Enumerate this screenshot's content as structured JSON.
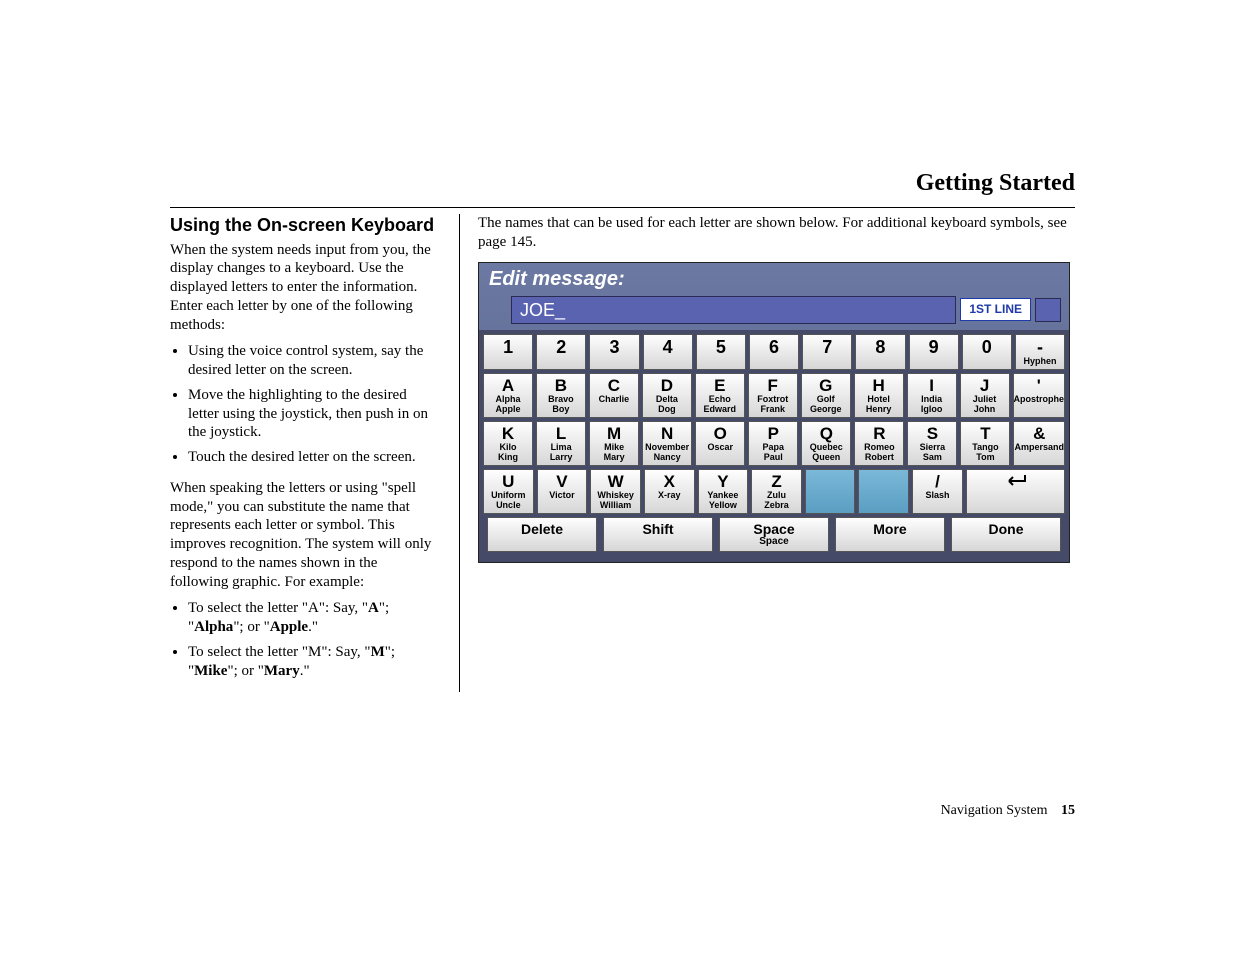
{
  "section_title": "Getting Started",
  "left": {
    "heading": "Using the On-screen Keyboard",
    "para1": "When the system needs input from you, the display changes to a keyboard. Use the displayed letters to enter the information. Enter each letter by one of the following methods:",
    "bullets1": [
      "Using the voice control system, say the desired letter on the screen.",
      "Move the highlighting to the desired letter using the joystick, then push in on the joystick.",
      "Touch the desired letter on the screen."
    ],
    "para2": "When speaking the letters or using \"spell mode,\" you can substitute the name that represents each letter or symbol. This improves recognition. The system will only respond to the names shown in the following graphic. For example:",
    "ex_a_1": "To select the letter \"A\": Say, \"",
    "ex_a_A": "A",
    "ex_a_2": "\"; \"",
    "ex_a_Alpha": "Alpha",
    "ex_a_3": "\"; or \"",
    "ex_a_Apple": "Apple",
    "ex_a_4": ".\"",
    "ex_m_1": "To select the letter \"M\": Say, \"",
    "ex_m_M": "M",
    "ex_m_2": "\"; \"",
    "ex_m_Mike": "Mike",
    "ex_m_3": "\"; or \"",
    "ex_m_Mary": "Mary",
    "ex_m_4": ".\""
  },
  "right_intro": "The names that can be used for each letter are shown below. For additional keyboard symbols, see page 145.",
  "kbd": {
    "title": "Edit message:",
    "input_value": "JOE_",
    "line_button": "1ST LINE",
    "row_nums": [
      {
        "big": "1"
      },
      {
        "big": "2"
      },
      {
        "big": "3"
      },
      {
        "big": "4"
      },
      {
        "big": "5"
      },
      {
        "big": "6"
      },
      {
        "big": "7"
      },
      {
        "big": "8"
      },
      {
        "big": "9"
      },
      {
        "big": "0"
      },
      {
        "big": "-",
        "sm": "Hyphen"
      }
    ],
    "row_a": [
      {
        "big": "A",
        "sm": "Alpha",
        "sm2": "Apple"
      },
      {
        "big": "B",
        "sm": "Bravo",
        "sm2": "Boy"
      },
      {
        "big": "C",
        "sm": "Charlie"
      },
      {
        "big": "D",
        "sm": "Delta",
        "sm2": "Dog"
      },
      {
        "big": "E",
        "sm": "Echo",
        "sm2": "Edward"
      },
      {
        "big": "F",
        "sm": "Foxtrot",
        "sm2": "Frank"
      },
      {
        "big": "G",
        "sm": "Golf",
        "sm2": "George"
      },
      {
        "big": "H",
        "sm": "Hotel",
        "sm2": "Henry"
      },
      {
        "big": "I",
        "sm": "India",
        "sm2": "Igloo"
      },
      {
        "big": "J",
        "sm": "Juliet",
        "sm2": "John"
      },
      {
        "big": "'",
        "sm": "Apostrophe"
      }
    ],
    "row_k": [
      {
        "big": "K",
        "sm": "Kilo",
        "sm2": "King"
      },
      {
        "big": "L",
        "sm": "Lima",
        "sm2": "Larry"
      },
      {
        "big": "M",
        "sm": "Mike",
        "sm2": "Mary"
      },
      {
        "big": "N",
        "sm": "November",
        "sm2": "Nancy"
      },
      {
        "big": "O",
        "sm": "Oscar"
      },
      {
        "big": "P",
        "sm": "Papa",
        "sm2": "Paul"
      },
      {
        "big": "Q",
        "sm": "Quebec",
        "sm2": "Queen"
      },
      {
        "big": "R",
        "sm": "Romeo",
        "sm2": "Robert"
      },
      {
        "big": "S",
        "sm": "Sierra",
        "sm2": "Sam"
      },
      {
        "big": "T",
        "sm": "Tango",
        "sm2": "Tom"
      },
      {
        "big": "&",
        "sm": "Ampersand"
      }
    ],
    "row_u": [
      {
        "big": "U",
        "sm": "Uniform",
        "sm2": "Uncle"
      },
      {
        "big": "V",
        "sm": "Victor"
      },
      {
        "big": "W",
        "sm": "Whiskey",
        "sm2": "William"
      },
      {
        "big": "X",
        "sm": "X-ray"
      },
      {
        "big": "Y",
        "sm": "Yankee",
        "sm2": "Yellow"
      },
      {
        "big": "Z",
        "sm": "Zulu",
        "sm2": "Zebra"
      },
      {
        "blue": true
      },
      {
        "blue": true
      },
      {
        "big": "/",
        "sm": "Slash"
      },
      {
        "enter": true
      }
    ],
    "bottom": [
      {
        "label": "Delete"
      },
      {
        "label": "Shift"
      },
      {
        "label": "Space",
        "sm": "Space"
      },
      {
        "label": "More"
      },
      {
        "label": "Done"
      }
    ]
  },
  "footer_label": "Navigation System",
  "footer_page": "15"
}
